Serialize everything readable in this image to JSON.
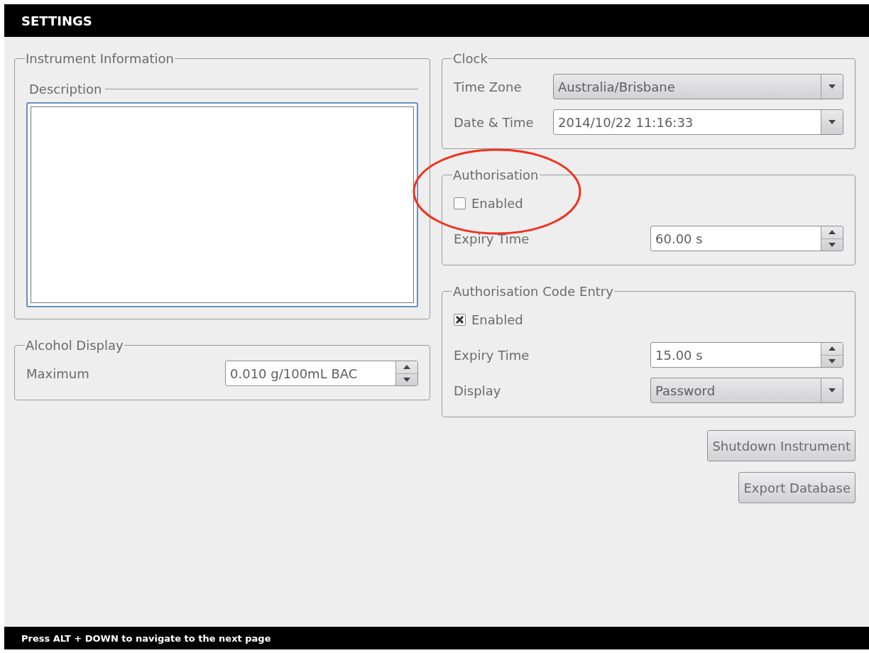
{
  "header": {
    "title": "SETTINGS"
  },
  "left_groups": [
    {
      "title": "Instrument Information",
      "description": {
        "label": "Description"
      }
    },
    {
      "title": "Alcohol Display",
      "rows": [
        {
          "kind": "spin",
          "label": "Maximum",
          "value": "0.010 g/100mL BAC"
        }
      ]
    }
  ],
  "right_groups": [
    {
      "title": "Clock",
      "rows": [
        {
          "kind": "combo",
          "label": "Time Zone",
          "value": "Australia/Brisbane"
        },
        {
          "kind": "editable_combo",
          "label": "Date & Time",
          "value": "2014/10/22 11:16:33"
        }
      ]
    },
    {
      "title": "Authorisation",
      "rows": [
        {
          "kind": "checkbox",
          "label": "Enabled",
          "checked": false
        },
        {
          "kind": "spin",
          "label": "Expiry Time",
          "value": "60.00 s"
        }
      ]
    },
    {
      "title": "Authorisation Code Entry",
      "rows": [
        {
          "kind": "checkbox",
          "label": "Enabled",
          "checked": true
        },
        {
          "kind": "spin",
          "label": "Expiry Time",
          "value": "15.00 s"
        },
        {
          "kind": "combo",
          "label": "Display",
          "value": "Password"
        }
      ]
    }
  ],
  "buttons": [
    "Shutdown Instrument",
    "Export Database"
  ],
  "status_bar": {
    "text": "Press ALT + DOWN to navigate to the next page"
  }
}
